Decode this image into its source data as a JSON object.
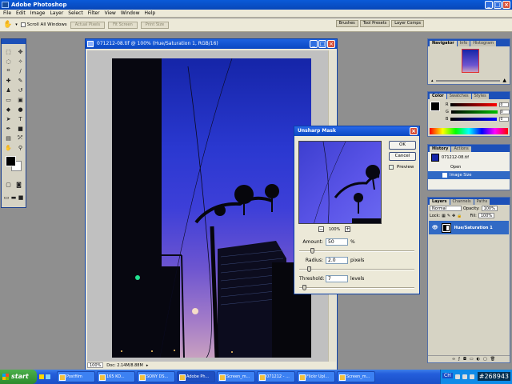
{
  "app": {
    "title": "Adobe Photoshop"
  },
  "menu": [
    "File",
    "Edit",
    "Image",
    "Layer",
    "Select",
    "Filter",
    "View",
    "Window",
    "Help"
  ],
  "options_bar": {
    "scroll_all_windows": "Scroll All Windows",
    "actual_pixels": "Actual Pixels",
    "fit_screen": "Fit Screen",
    "print_size": "Print Size",
    "palette_well": [
      "Brushes",
      "Tool Presets",
      "Layer Comps"
    ]
  },
  "document": {
    "title": "071212-08.tif @ 100% (Hue/Saturation 1, RGB/16)",
    "zoom": "100%",
    "doc_info": "Doc: 2.14M/8.88M"
  },
  "dialog": {
    "title": "Unsharp Mask",
    "ok": "OK",
    "cancel": "Cancel",
    "preview_label": "Preview",
    "preview_checked": true,
    "zoom": "100%",
    "zoom_out": "−",
    "zoom_in": "+",
    "amount_label": "Amount:",
    "amount_value": "50",
    "amount_unit": "%",
    "amount_level": 0.1,
    "radius_label": "Radius:",
    "radius_value": "2.0",
    "radius_unit": "pixels",
    "radius_level": 0.07,
    "threshold_label": "Threshold:",
    "threshold_value": "7",
    "threshold_unit": "levels",
    "threshold_level": 0.03
  },
  "navigator": {
    "tabs": [
      "Navigator",
      "Info",
      "Histogram"
    ]
  },
  "color": {
    "tabs": [
      "Color",
      "Swatches",
      "Styles"
    ],
    "channels": [
      {
        "label": "R",
        "value": "0",
        "color": "#ff0000"
      },
      {
        "label": "G",
        "value": "0",
        "color": "#00c000"
      },
      {
        "label": "B",
        "value": "0",
        "color": "#0000ff"
      }
    ]
  },
  "history": {
    "tabs": [
      "History",
      "Actions"
    ],
    "snapshot": "071212-08.tif",
    "items": [
      {
        "label": "Open",
        "selected": false
      },
      {
        "label": "Image Size",
        "selected": true
      }
    ]
  },
  "layers": {
    "tabs": [
      "Layers",
      "Channels",
      "Paths"
    ],
    "blend_mode": "Normal",
    "opacity_label": "Opacity:",
    "opacity": "100%",
    "lock_label": "Lock:",
    "fill_label": "Fill:",
    "fill": "100%",
    "layer_name": "Hue/Saturation 1"
  },
  "taskbar": {
    "start": "start",
    "tasks": [
      {
        "label": "Postfilm",
        "active": false
      },
      {
        "label": "165 KO...",
        "active": false
      },
      {
        "label": "SONY DS...",
        "active": false
      },
      {
        "label": "Adobe Ph...",
        "active": true
      },
      {
        "label": "Screen_m...",
        "active": false
      },
      {
        "label": "071212 - ...",
        "active": false
      },
      {
        "label": "Flickr Upl...",
        "active": false
      },
      {
        "label": "Screen_m...",
        "active": false
      }
    ],
    "tray_lang": "CH",
    "watermark": "#268943"
  }
}
